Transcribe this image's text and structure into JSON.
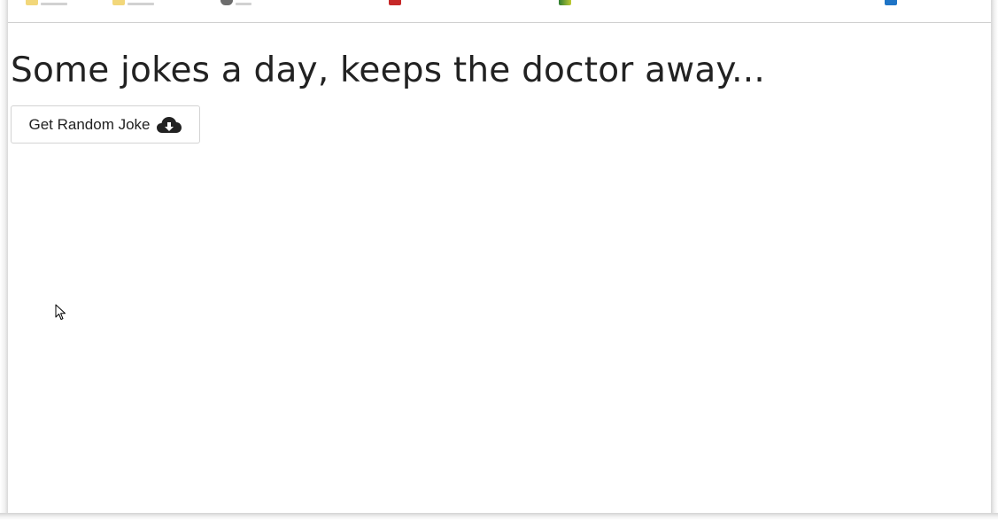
{
  "page": {
    "title": "Some jokes a day, keeps the doctor away...",
    "button_label": "Get Random Joke",
    "button_icon": "cloud-download-icon"
  },
  "colors": {
    "text": "#222222",
    "button_border": "#d3d3d3",
    "background": "#ffffff"
  },
  "bookmarks_bar": {
    "icons": [
      "folder-icon",
      "folder-icon",
      "globe-icon",
      "red-app-icon",
      "green-app-icon",
      "blue-app-icon"
    ]
  }
}
